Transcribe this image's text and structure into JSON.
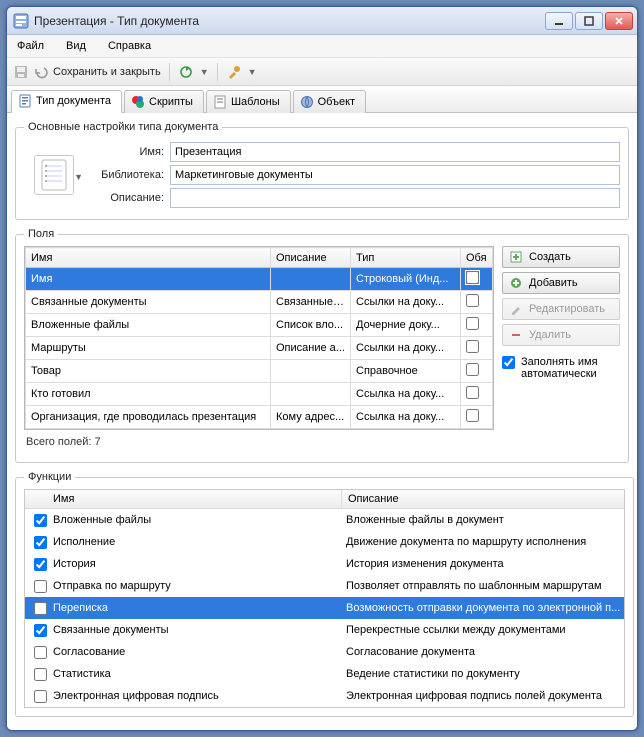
{
  "window": {
    "title": "Презентация - Тип документа"
  },
  "menu": {
    "file": "Файл",
    "view": "Вид",
    "help": "Справка"
  },
  "toolbar": {
    "save_close": "Сохранить и закрыть"
  },
  "tabs": {
    "doc_type": "Тип документа",
    "scripts": "Скрипты",
    "templates": "Шаблоны",
    "object": "Объект"
  },
  "settings": {
    "legend": "Основные настройки типа документа",
    "name_label": "Имя:",
    "name_value": "Презентация",
    "library_label": "Библиотека:",
    "library_value": "Маркетинговые документы",
    "description_label": "Описание:",
    "description_value": ""
  },
  "fields": {
    "legend": "Поля",
    "headers": {
      "name": "Имя",
      "desc": "Описание",
      "type": "Тип",
      "req": "Обя"
    },
    "rows": [
      {
        "name": "Имя",
        "desc": "",
        "type": "Строковый (Инд...",
        "req": false,
        "selected": true
      },
      {
        "name": "Связанные документы",
        "desc": "Связанные ...",
        "type": "Ссылки на доку...",
        "req": false
      },
      {
        "name": "Вложенные файлы",
        "desc": "Список вло...",
        "type": "Дочерние доку...",
        "req": false
      },
      {
        "name": "Маршруты",
        "desc": "Описание а...",
        "type": "Ссылки на доку...",
        "req": false
      },
      {
        "name": "Товар",
        "desc": "",
        "type": "Справочное",
        "req": false
      },
      {
        "name": "Кто готовил",
        "desc": "",
        "type": "Ссылка на доку...",
        "req": false
      },
      {
        "name": "Организация, где проводилась презентация",
        "desc": "Кому адрес...",
        "type": "Ссылка на доку...",
        "req": false
      }
    ],
    "totals": "Всего полей: 7",
    "buttons": {
      "create": "Создать",
      "add": "Добавить",
      "edit": "Редактировать",
      "delete": "Удалить"
    },
    "autoname_label": "Заполнять имя автоматически",
    "autoname_checked": true
  },
  "functions": {
    "legend": "Функции",
    "headers": {
      "name": "Имя",
      "desc": "Описание"
    },
    "rows": [
      {
        "checked": true,
        "name": "Вложенные файлы",
        "desc": "Вложенные файлы в документ"
      },
      {
        "checked": true,
        "name": "Исполнение",
        "desc": "Движение документа по маршруту исполнения"
      },
      {
        "checked": true,
        "name": "История",
        "desc": "История изменения документа"
      },
      {
        "checked": false,
        "name": "Отправка по маршруту",
        "desc": "Позволяет отправлять по шаблонным маршрутам"
      },
      {
        "checked": false,
        "name": "Переписка",
        "desc": "Возможность отправки документа по электронной п...",
        "selected": true
      },
      {
        "checked": true,
        "name": "Связанные документы",
        "desc": "Перекрестные ссылки между документами"
      },
      {
        "checked": false,
        "name": "Согласование",
        "desc": "Согласование документа"
      },
      {
        "checked": false,
        "name": "Статистика",
        "desc": "Ведение статистики по документу"
      },
      {
        "checked": false,
        "name": "Электронная цифровая подпись",
        "desc": "Электронная цифровая подпись полей документа"
      }
    ]
  }
}
